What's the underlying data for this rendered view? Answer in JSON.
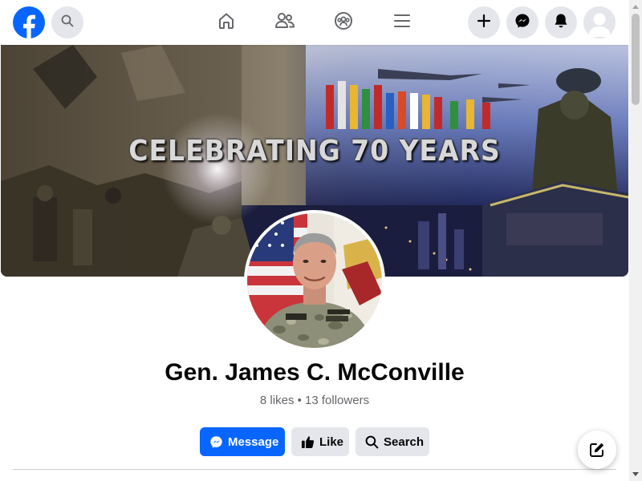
{
  "top_nav": {
    "logo": "facebook-logo",
    "search_icon": "search-icon",
    "items": [
      {
        "name": "home",
        "icon": "home-icon"
      },
      {
        "name": "friends",
        "icon": "friends-icon"
      },
      {
        "name": "groups",
        "icon": "groups-icon"
      },
      {
        "name": "menu",
        "icon": "menu-icon"
      }
    ],
    "right": [
      "plus-icon",
      "messenger-icon",
      "bell-icon",
      "avatar"
    ]
  },
  "cover": {
    "title": "CELEBRATING 70 YEARS"
  },
  "profile": {
    "name": "Gen. James C. McConville",
    "stats": "8 likes • 13 followers"
  },
  "actions": {
    "message": "Message",
    "like": "Like",
    "search": "Search"
  },
  "colors": {
    "brand": "#0866ff",
    "button_gray": "#e4e6eb",
    "secondary_text": "#65676b"
  }
}
